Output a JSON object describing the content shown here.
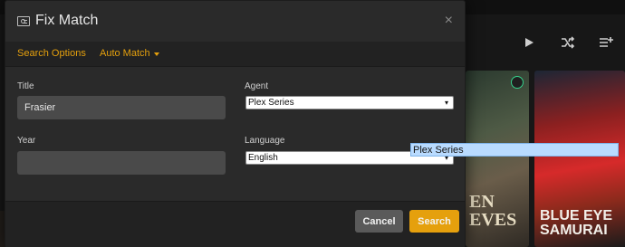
{
  "modal": {
    "title": "Fix Match",
    "close": "×",
    "tabs": [
      {
        "label": "Search Options"
      },
      {
        "label": "Auto Match"
      }
    ],
    "fields": {
      "title_label": "Title",
      "title_value": "Frasier",
      "year_label": "Year",
      "year_value": "",
      "agent_label": "Agent",
      "agent_value": "Plex Series",
      "language_label": "Language",
      "language_value": "English"
    },
    "dropdown_option": "Plex Series",
    "buttons": {
      "cancel": "Cancel",
      "search": "Search"
    }
  },
  "background": {
    "posters": [
      {
        "title": "EN EVES"
      },
      {
        "title": "BLUE EYE SAMURAI"
      }
    ],
    "toolbar_icons": [
      "play-icon",
      "shuffle-icon",
      "queue-icon"
    ]
  },
  "colors": {
    "accent": "#e5a00d",
    "modal_bg": "#2a2a2a",
    "input_bg": "#4a4a4a",
    "footer_bg": "#222222"
  }
}
